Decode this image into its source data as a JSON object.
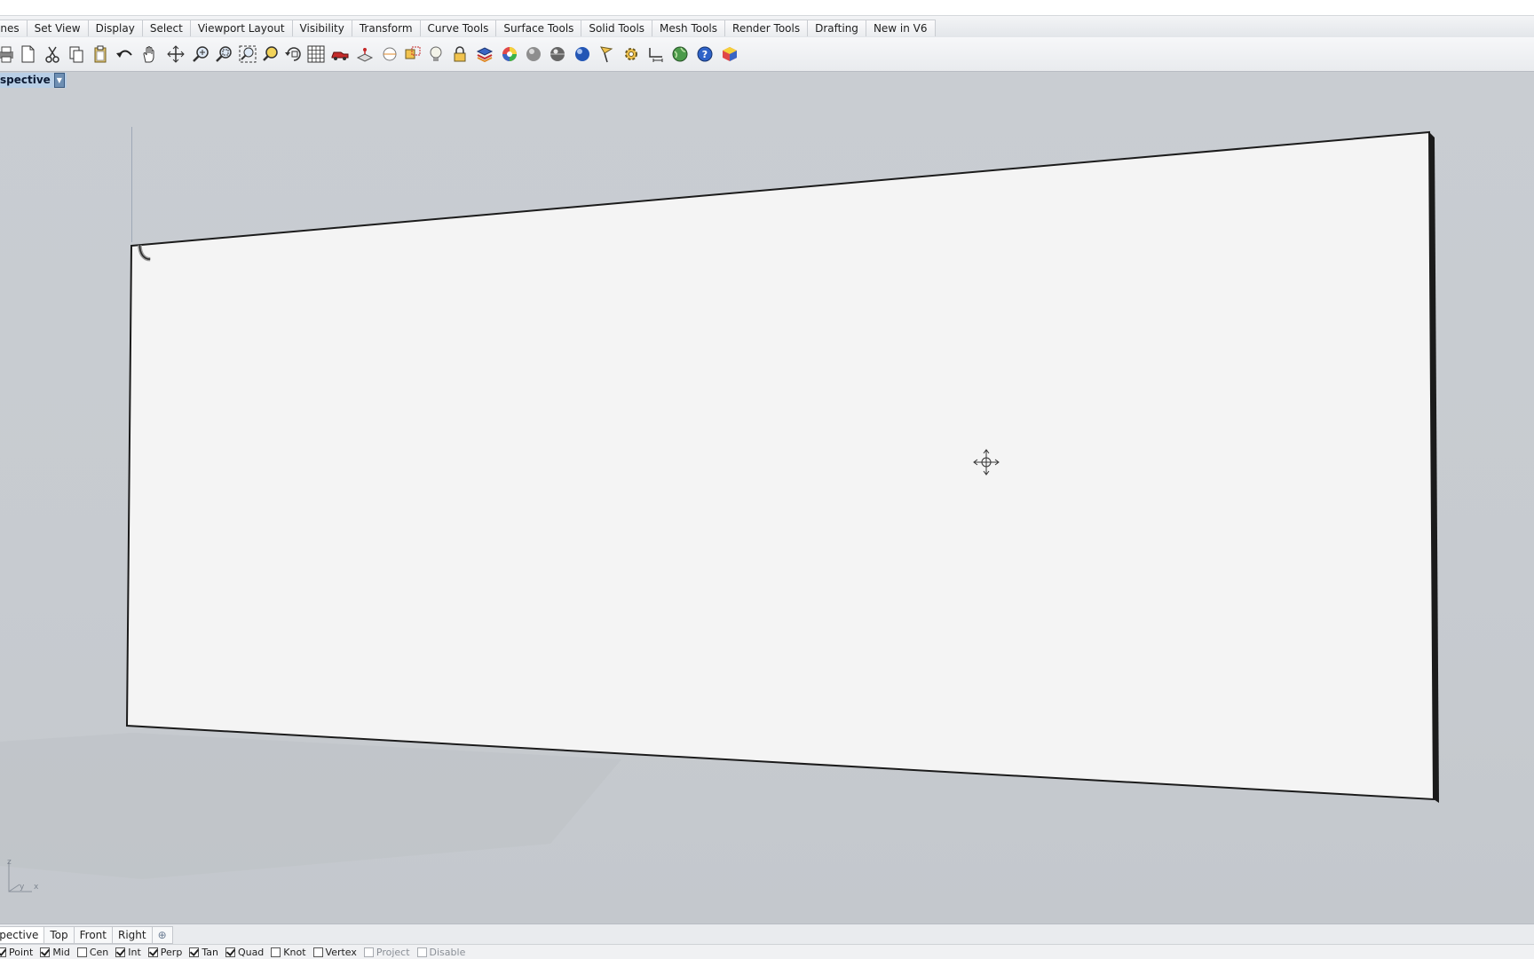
{
  "menu_tabs": [
    "anes",
    "Set View",
    "Display",
    "Select",
    "Viewport Layout",
    "Visibility",
    "Transform",
    "Curve Tools",
    "Surface Tools",
    "Solid Tools",
    "Mesh Tools",
    "Render Tools",
    "Drafting",
    "New in V6"
  ],
  "toolbar_icons": [
    "print-icon",
    "new-file-icon",
    "cut-icon",
    "copy-icon",
    "paste-icon",
    "undo-icon",
    "pan-hand-icon",
    "move-cross-icon",
    "zoom-in-icon",
    "zoom-window-icon",
    "zoom-extents-icon",
    "zoom-selected-icon",
    "rotate-view-icon",
    "four-viewports-icon",
    "car-icon",
    "cplane-icon",
    "circle-icon",
    "named-view-icon",
    "light-bulb-icon",
    "lock-icon",
    "layer-icon",
    "color-wheel-icon",
    "shade-sphere-icon",
    "render-sphere-icon",
    "material-sphere-icon",
    "flag-icon",
    "gear-icon",
    "dimension-icon",
    "earth-icon",
    "help-icon",
    "render-cube-icon"
  ],
  "viewport": {
    "title": "spective"
  },
  "view_tabs": [
    "spective",
    "Top",
    "Front",
    "Right"
  ],
  "add_view_symbol": "⊕",
  "axis_labels": {
    "z": "z",
    "y": "y",
    "x": "x"
  },
  "osnaps": [
    {
      "label": "Point",
      "checked": true
    },
    {
      "label": "Mid",
      "checked": true
    },
    {
      "label": "Cen",
      "checked": false
    },
    {
      "label": "Int",
      "checked": true
    },
    {
      "label": "Perp",
      "checked": true
    },
    {
      "label": "Tan",
      "checked": true
    },
    {
      "label": "Quad",
      "checked": true
    },
    {
      "label": "Knot",
      "checked": false
    },
    {
      "label": "Vertex",
      "checked": false
    },
    {
      "label": "Project",
      "checked": false
    },
    {
      "label": "Disable",
      "checked": false
    }
  ],
  "colors": {
    "viewport_bg": "#c9cdd2",
    "panel_face": "#f4f4f4",
    "panel_edge": "#1b1b1b",
    "pattern_stroke": "#2a2a2a",
    "title_highlight": "#b9cfe6"
  }
}
